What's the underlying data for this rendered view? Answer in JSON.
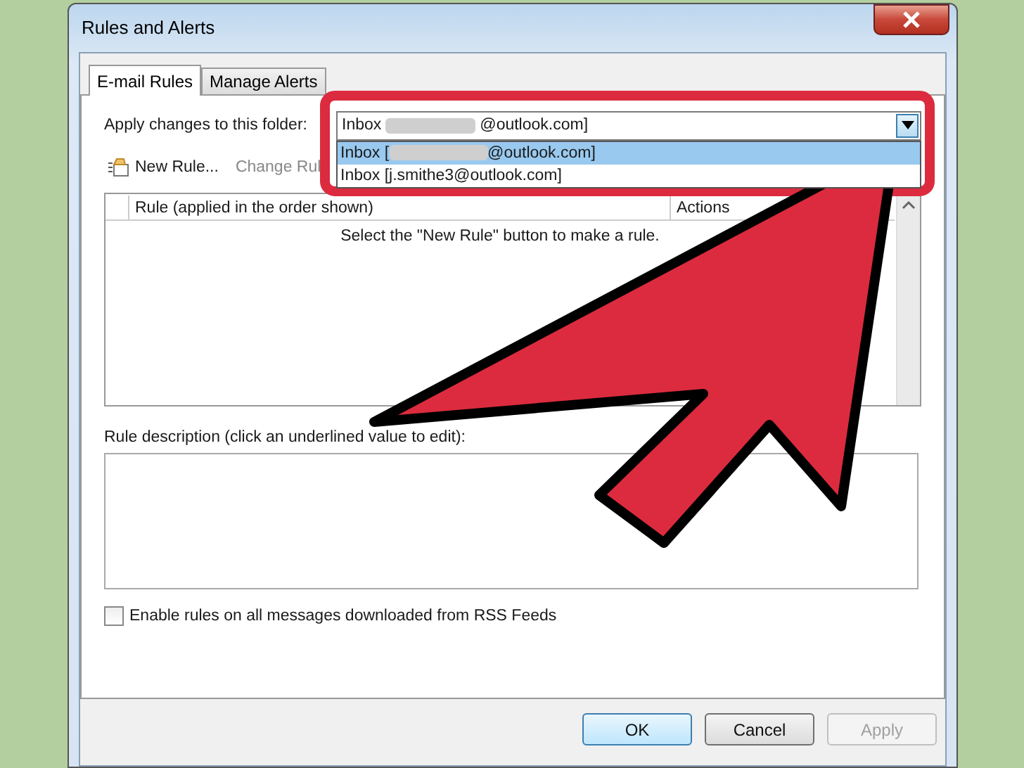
{
  "window": {
    "title": "Rules and Alerts"
  },
  "tabs": [
    {
      "label": "E-mail Rules",
      "selected": true
    },
    {
      "label": "Manage Alerts",
      "selected": false
    }
  ],
  "folder": {
    "label": "Apply changes to this folder:",
    "value_prefix": "Inbox",
    "value_suffix": "@outlook.com]",
    "expanded": true,
    "options": [
      {
        "prefix": "Inbox [",
        "suffix": "@outlook.com]",
        "redacted": true,
        "selected": true
      },
      {
        "prefix": "Inbox [j.smithe3@outlook.com]",
        "redacted": false,
        "selected": false
      }
    ]
  },
  "toolbar": [
    {
      "label": "New Rule...",
      "kind": "new",
      "disabled": false
    },
    {
      "label": "Change Rul",
      "kind": "change",
      "disabled": true
    }
  ],
  "table": {
    "columns": [
      "Rule (applied in the order shown)",
      "Actions"
    ],
    "empty_message": "Select the \"New Rule\" button to make a rule."
  },
  "description": {
    "label": "Rule description (click an underlined value to edit):"
  },
  "rss_checkbox": {
    "label": "Enable rules on all messages downloaded from RSS Feeds",
    "checked": false
  },
  "buttons": [
    {
      "label": "OK",
      "default": true,
      "disabled": false
    },
    {
      "label": "Cancel",
      "default": false,
      "disabled": false
    },
    {
      "label": "Apply",
      "default": false,
      "disabled": true
    }
  ]
}
